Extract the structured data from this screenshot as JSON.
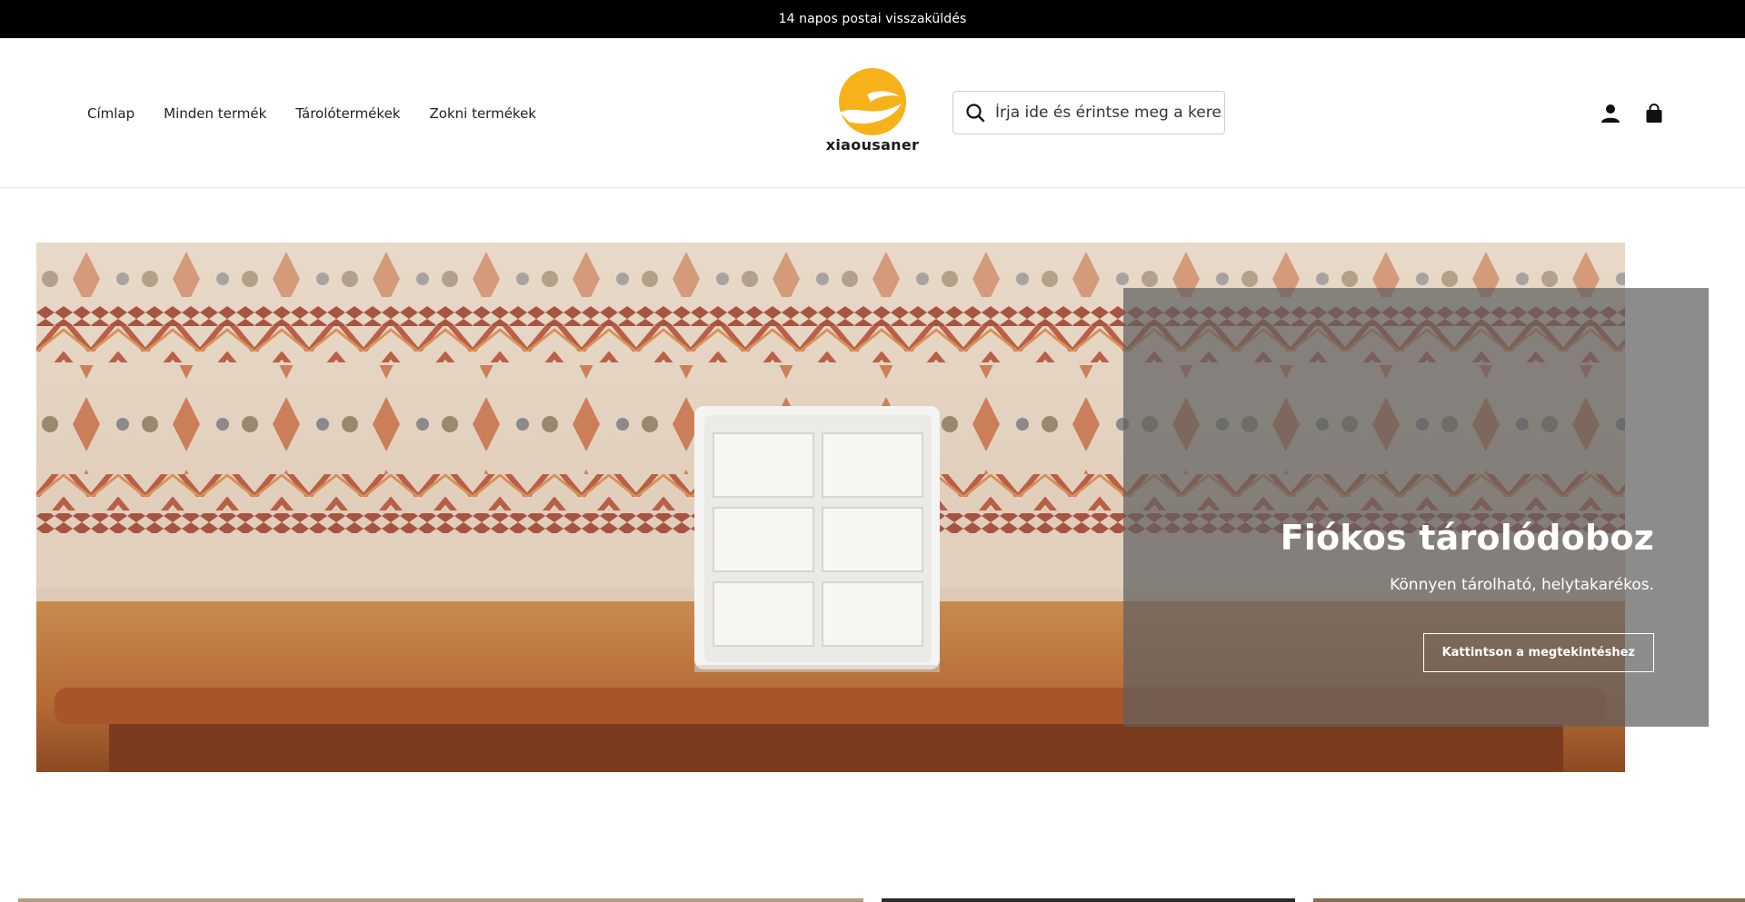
{
  "announcement": {
    "text": "14 napos postai visszaküldés"
  },
  "nav": {
    "items": [
      {
        "label": "Címlap"
      },
      {
        "label": "Minden termék"
      },
      {
        "label": "Tárolótermékek"
      },
      {
        "label": "Zokni termékek"
      }
    ]
  },
  "logo": {
    "text": "xiaousaner",
    "color": "#F7B21B"
  },
  "search": {
    "placeholder": "Írja ide és érintse meg a keresést",
    "icon": "search-icon"
  },
  "header_icons": {
    "account": "account-icon",
    "cart": "shopping-bag-icon"
  },
  "hero": {
    "title": "Fiókos tárolódoboz",
    "subtitle": "Könnyen tárolható, helytakarékos.",
    "button_label": "Kattintson a megtekintéshez"
  },
  "colors": {
    "announcement_bg": "#000000",
    "overlay": "#5f5f5f",
    "brand": "#F7B21B"
  }
}
